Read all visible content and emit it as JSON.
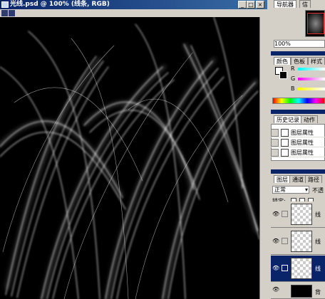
{
  "document": {
    "title": "光线.psd @ 100% (线条, RGB)",
    "min_label": "_",
    "max_label": "□",
    "close_label": "×"
  },
  "navigator": {
    "tab1": "导航器",
    "tab2": "信",
    "zoom": "100%"
  },
  "color": {
    "tab_color": "颜色",
    "tab_swatches": "色板",
    "tab_styles": "样式",
    "r": "R",
    "g": "G",
    "b": "B"
  },
  "history": {
    "tab_history": "历史记录",
    "tab_actions": "动作",
    "items": [
      {
        "label": "图层属性"
      },
      {
        "label": "图层属性"
      },
      {
        "label": "图层属性"
      }
    ]
  },
  "layers": {
    "tab_layers": "图层",
    "tab_channels": "通道",
    "tab_paths": "路径",
    "blend_mode": "正常",
    "opacity_label": "不透",
    "lock_label": "锁定:",
    "rows": [
      {
        "name": "线"
      },
      {
        "name": "线"
      },
      {
        "name": "线"
      },
      {
        "name": "背"
      }
    ]
  },
  "colors": {
    "titlebar": "#0a246a",
    "panel": "#d4d0c8",
    "canvas": "#000000"
  }
}
